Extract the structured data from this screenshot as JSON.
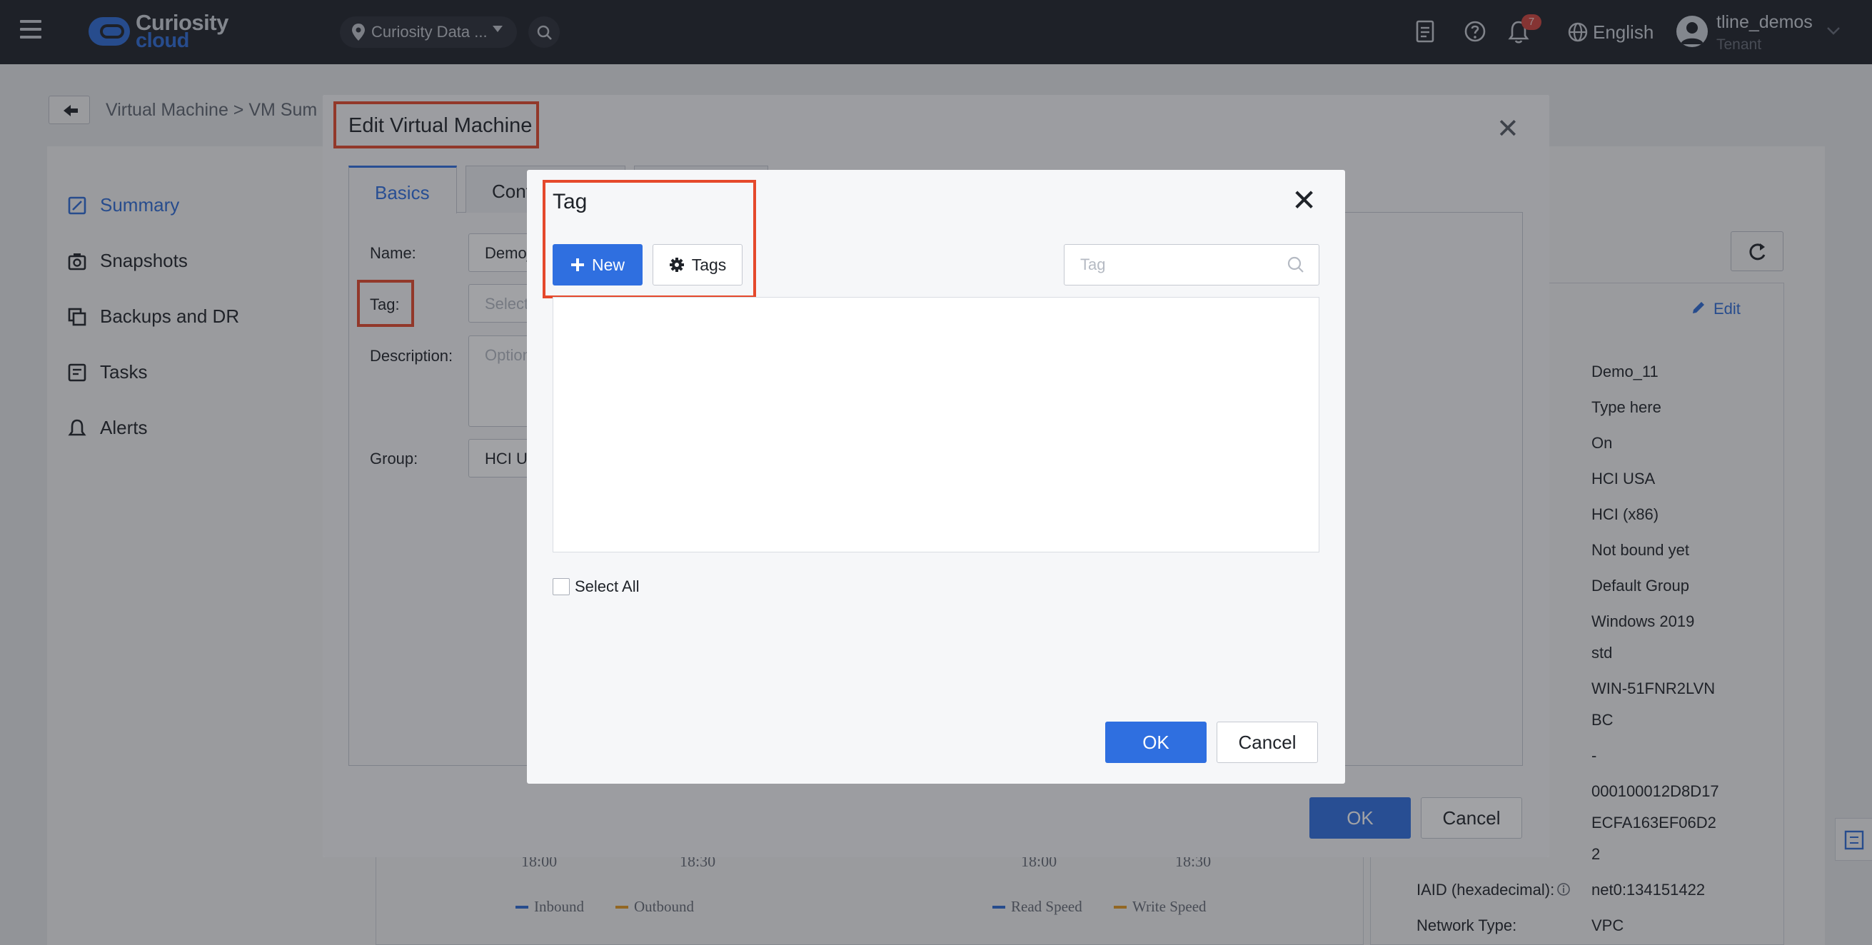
{
  "topbar": {
    "logo_line1": "Curiosity",
    "logo_line2": "cloud",
    "location": "Curiosity Data ...",
    "notification_count": "7",
    "language": "English",
    "user_name": "tline_demos",
    "user_role": "Tenant"
  },
  "page": {
    "breadcrumb": "Virtual Machine > VM Sum",
    "nav": [
      "Summary",
      "Snapshots",
      "Backups and DR",
      "Tasks",
      "Alerts"
    ],
    "edit_label": "Edit",
    "info_values": [
      "Demo_11",
      "Type here",
      "On",
      "HCI USA",
      "HCI (x86)",
      "Not bound yet",
      "Default Group",
      "Windows 2019",
      "std",
      "WIN-51FNR2LVN",
      "BC",
      "-",
      "000100012D8D17",
      "ECFA163EF06D2",
      "2",
      "net0:134151422",
      "VPC"
    ],
    "info_keys": {
      "iaid": "IAID (hexadecimal):",
      "network_type": "Network Type:"
    },
    "chart_ticks": [
      "18:00",
      "18:30",
      "18:00",
      "18:30"
    ],
    "chart_legends": [
      "Inbound",
      "Outbound",
      "Read Speed",
      "Write Speed"
    ]
  },
  "vm_modal": {
    "title": "Edit Virtual Machine",
    "tabs": [
      "Basics",
      "Conf",
      ""
    ],
    "fields": {
      "name_label": "Name:",
      "name_value": "Demo_",
      "tag_label": "Tag:",
      "tag_placeholder": "Select",
      "desc_label": "Description:",
      "desc_placeholder": "Option",
      "group_label": "Group:",
      "group_value": "HCI U"
    },
    "ok": "OK",
    "cancel": "Cancel"
  },
  "tag_dialog": {
    "title": "Tag",
    "new_button": "New",
    "tags_button": "Tags",
    "search_placeholder": "Tag",
    "select_all": "Select All",
    "ok": "OK",
    "cancel": "Cancel"
  },
  "colors": {
    "accent": "#2f6fe0",
    "highlight": "#e5492c",
    "topbar": "#1e2129"
  }
}
